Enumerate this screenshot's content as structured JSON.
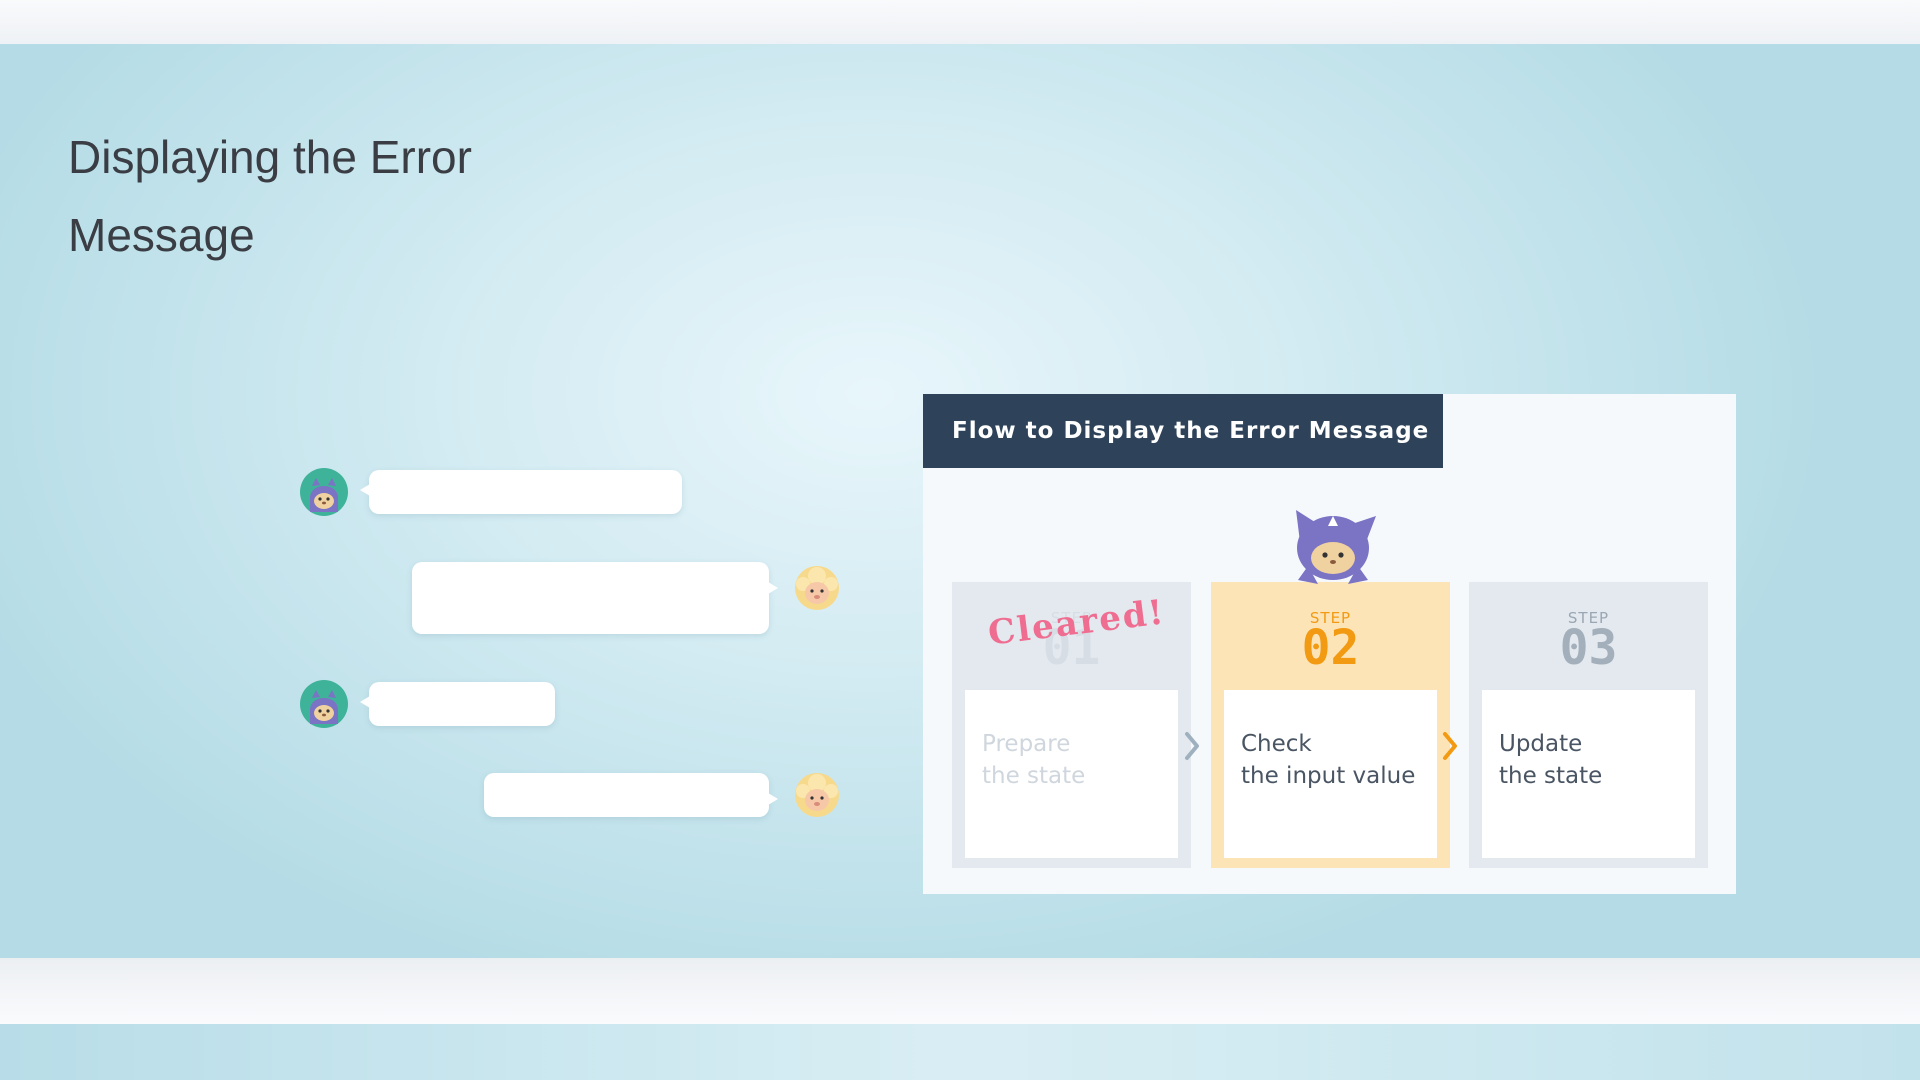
{
  "slide": {
    "title": "Displaying the Error Message"
  },
  "chat": {
    "messages": [
      {
        "speaker": "purple-cat",
        "side": "left",
        "text": ""
      },
      {
        "speaker": "sheep",
        "side": "right",
        "text": ""
      },
      {
        "speaker": "purple-cat",
        "side": "left",
        "text": ""
      },
      {
        "speaker": "sheep",
        "side": "right",
        "text": ""
      }
    ]
  },
  "flow": {
    "heading": "Flow to Display the Error Message",
    "stamp": "Cleared!",
    "steps": [
      {
        "label": "STEP",
        "number": "01",
        "text": "Prepare\nthe state",
        "status": "cleared"
      },
      {
        "label": "STEP",
        "number": "02",
        "text": "Check\nthe input value",
        "status": "active"
      },
      {
        "label": "STEP",
        "number": "03",
        "text": "Update\nthe state",
        "status": "pending"
      }
    ]
  },
  "colors": {
    "header": "#2e435a",
    "active_step": "#fde4b7",
    "active_accent": "#f29a12",
    "stamp": "#ef6d90",
    "inactive_step": "#e3e9ef"
  },
  "icons": {
    "left_avatar": "purple-cat-avatar-icon",
    "right_avatar": "sheep-avatar-icon",
    "mascot": "purple-cat-mascot-icon",
    "arrow": "chevron-right-icon"
  }
}
